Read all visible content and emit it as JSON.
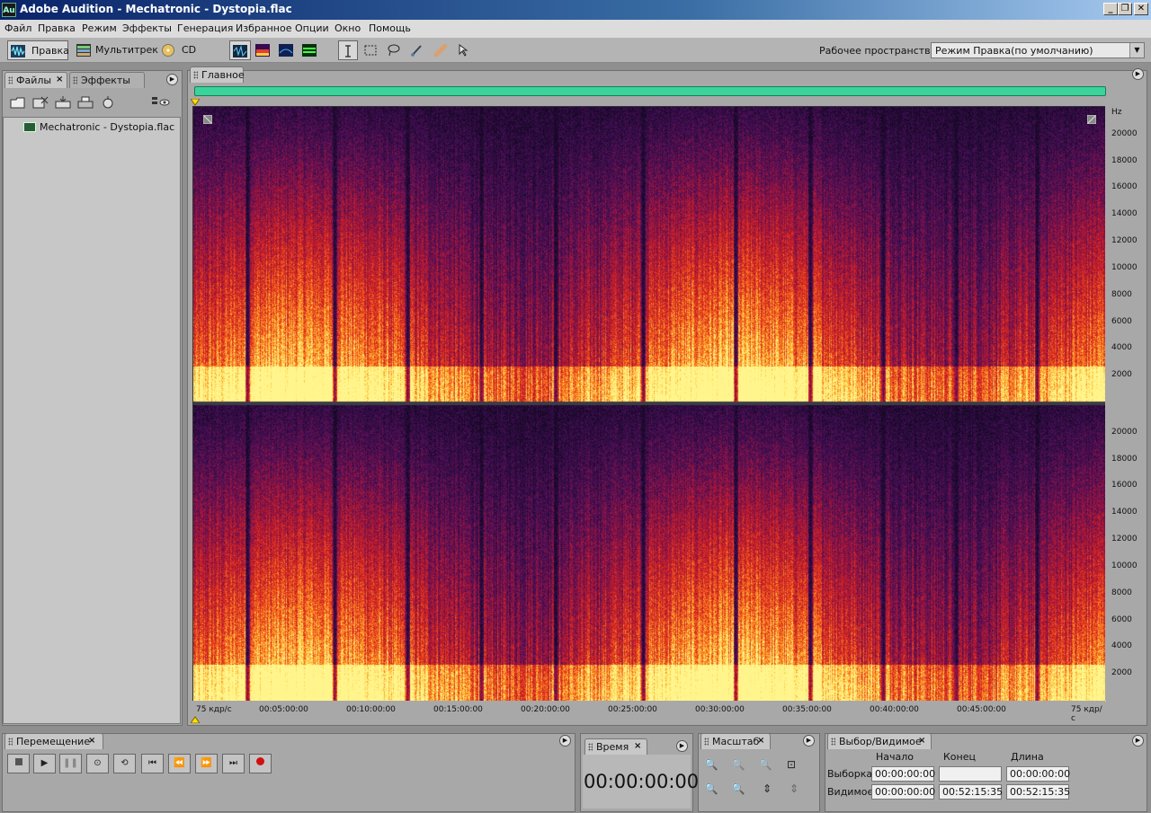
{
  "window": {
    "app_icon": "Au",
    "title": "Adobe Audition - Mechatronic - Dystopia.flac",
    "controls": [
      "_",
      "❐",
      "✕"
    ]
  },
  "menu": [
    "Файл",
    "Правка",
    "Режим",
    "Эффекты",
    "Генерация",
    "Избранное",
    "Опции",
    "Окно",
    "Помощь"
  ],
  "toolbar": {
    "modes": {
      "edit": "Правка",
      "multitrack": "Мультитрек",
      "cd": "CD"
    },
    "workspace_label": "Рабочее пространство:",
    "workspace_value": "Режим Правка(по умолчанию)"
  },
  "files_panel": {
    "tabs": [
      "Файлы",
      "Эффекты"
    ],
    "files": [
      "Mechatronic - Dystopia.flac"
    ]
  },
  "main_panel": {
    "tab": "Главное",
    "hz_unit": "Hz",
    "hz_ticks": [
      "20000",
      "18000",
      "16000",
      "14000",
      "12000",
      "10000",
      "8000",
      "6000",
      "4000",
      "2000"
    ],
    "time_ticks": [
      "00:05:00:00",
      "00:10:00:00",
      "00:15:00:00",
      "00:20:00:00",
      "00:25:00:00",
      "00:30:00:00",
      "00:35:00:00",
      "00:40:00:00",
      "00:45:00:00"
    ],
    "frame_rate_left": "75 кдр/с",
    "frame_rate_right": "75 кдр/с"
  },
  "transport": {
    "tab": "Перемещение"
  },
  "time_panel": {
    "tab": "Время",
    "value": "00:00:00:00"
  },
  "zoom_panel": {
    "tab": "Масштаб"
  },
  "selection_panel": {
    "tab": "Выбор/Видимое",
    "headers": {
      "start": "Начало",
      "end": "Конец",
      "length": "Длина"
    },
    "selection": {
      "label": "Выборка",
      "start": "00:00:00:00",
      "end": "",
      "length": "00:00:00:00"
    },
    "view": {
      "label": "Видимое",
      "start": "00:00:00:00",
      "end": "00:52:15:35",
      "length": "00:52:15:35"
    }
  },
  "colors": {
    "overview_bar": "#3ad49a",
    "spectrogram_hot": "#ffe060",
    "spectrogram_cold": "#2a0a40"
  }
}
